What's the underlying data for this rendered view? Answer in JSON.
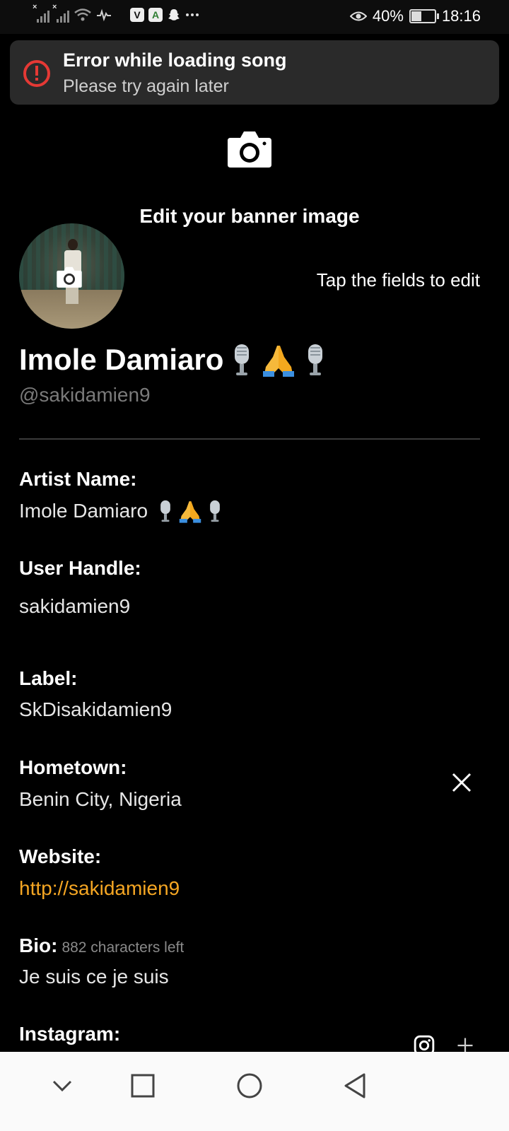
{
  "status_bar": {
    "battery_percent": "40%",
    "battery_level": 0.4,
    "time": "18:16",
    "app_icons": [
      "signal-1-icon",
      "signal-2-icon",
      "wifi-icon",
      "activity-icon",
      "viber-icon",
      "android-icon",
      "snapchat-icon",
      "more-dots-icon",
      "eye-icon",
      "battery-icon"
    ]
  },
  "toast": {
    "title": "Error while loading song",
    "message": "Please try again later",
    "icon": "error-icon",
    "icon_color": "#e53935"
  },
  "banner": {
    "title": "Edit your banner image",
    "icon": "camera-icon"
  },
  "profile": {
    "hint": "Tap the fields to edit",
    "artist_name": "Imole Damiaro",
    "handle": "@sakidamien9"
  },
  "fields": {
    "artist_name_label": "Artist Name:",
    "artist_name_value": "Imole Damiaro",
    "user_handle_label": "User Handle:",
    "user_handle_value": "sakidamien9",
    "label_label": "Label:",
    "label_value": "SkDisakidamien9",
    "hometown_label": "Hometown:",
    "hometown_value": "Benin City, Nigeria",
    "website_label": "Website:",
    "website_value": "http://sakidamien9",
    "bio_label": "Bio:",
    "bio_count": "882 characters left",
    "bio_value": "Je suis ce je suis",
    "instagram_label": "Instagram:"
  },
  "colors": {
    "background": "#000000",
    "link": "#f5a623",
    "muted": "#7a7a7a",
    "error": "#e53935"
  },
  "navbar": {
    "icons": [
      "collapse-chevron-icon",
      "recents-square-icon",
      "home-circle-icon",
      "back-triangle-icon"
    ]
  }
}
